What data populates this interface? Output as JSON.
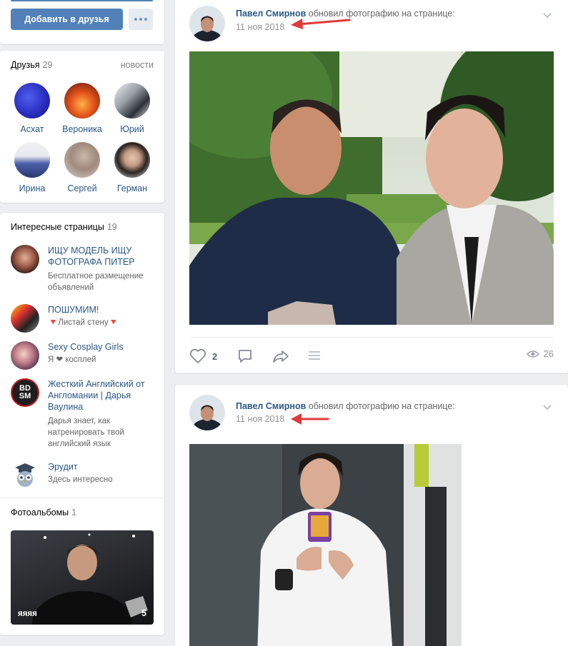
{
  "profile_actions": {
    "add_friend": "Добавить в друзья"
  },
  "friends": {
    "title": "Друзья",
    "count": "29",
    "news_link": "новости",
    "items": [
      {
        "name": "Асхат"
      },
      {
        "name": "Вероника"
      },
      {
        "name": "Юрий"
      },
      {
        "name": "Ирина"
      },
      {
        "name": "Сергей"
      },
      {
        "name": "Герман"
      }
    ]
  },
  "pages": {
    "title": "Интересные страницы",
    "count": "19",
    "items": [
      {
        "title": "ИЩУ МОДЕЛЬ ИЩУ ФОТОГРАФА ПИТЕР",
        "desc": "Бесплатное размещение объявлений"
      },
      {
        "title": "ПОШУМИМ!",
        "desc": "🔻Листай стену🔻"
      },
      {
        "title": "Sexy Cosplay Girls",
        "desc": "Я ❤ косплей"
      },
      {
        "title": "Жесткий Английский от Англомании | Дарья Ваулина",
        "desc": "Дарья знает, как натренировать твой английский язык"
      },
      {
        "title": "Эрудит",
        "desc": "Здесь интересно"
      }
    ],
    "bdsm_logo_line1": "BD",
    "bdsm_logo_line2": "SM"
  },
  "albums": {
    "title": "Фотоальбомы",
    "count": "1",
    "album_name": "яяяя",
    "album_count": "5"
  },
  "posts": [
    {
      "author": "Павел Смирнов",
      "action": "обновил фотографию на странице:",
      "date": "11 ноя 2018",
      "likes": "2",
      "views": "26"
    },
    {
      "author": "Павел Смирнов",
      "action": "обновил фотографию на странице:",
      "date": "11 ноя 2018"
    }
  ],
  "colors": {
    "accent": "#5181b8",
    "link": "#2a5885",
    "background": "#edeef0",
    "annotation_arrow": "#e03a3a"
  },
  "icons": [
    "more-icon",
    "chevron-down-icon",
    "like-icon",
    "comment-icon",
    "share-icon",
    "menu-icon",
    "views-icon",
    "annotation-arrow"
  ]
}
